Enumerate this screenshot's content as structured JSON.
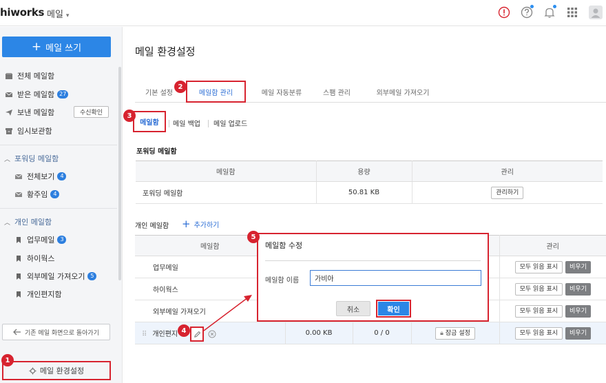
{
  "header": {
    "logo": "hiworks",
    "app_name": "메일",
    "app_caret": "▾",
    "icons": [
      "alert-icon",
      "help-icon",
      "bell-icon",
      "apps-grid-icon",
      "avatar"
    ],
    "accent": "#2c86e6",
    "alert_color": "#d7232f"
  },
  "sidebar": {
    "compose_plus": "+",
    "compose_label": "메일 쓰기",
    "items": [
      {
        "label": "전체 메일함",
        "icon": "mailbox-icon"
      },
      {
        "label": "받은 메일함",
        "icon": "inbox-icon",
        "badge": "27"
      },
      {
        "label": "보낸 메일함",
        "icon": "send-icon",
        "action": "수신확인"
      },
      {
        "label": "임시보관함",
        "icon": "archive-icon"
      }
    ],
    "forward_group": {
      "label": "포워딩 메일함",
      "items": [
        {
          "label": "전체보기",
          "badge": "4"
        },
        {
          "label": "황주임",
          "badge": "4"
        }
      ]
    },
    "personal_group": {
      "label": "개인 메일함",
      "items": [
        {
          "label": "업무메일",
          "badge": "3"
        },
        {
          "label": "하이웍스",
          "badge": ""
        },
        {
          "label": "외부메일 가져오기",
          "badge": "5"
        },
        {
          "label": "개인편지함",
          "badge": ""
        }
      ]
    },
    "old_view": "기존 메일 화면으로 돌아가기",
    "settings": "메일 환경설정"
  },
  "markers": [
    "1",
    "2",
    "3",
    "4",
    "5"
  ],
  "main": {
    "title": "메일 환경설정",
    "tabs": [
      "기본 설정",
      "메일함 관리",
      "메일 자동분류",
      "스팸 관리",
      "외부메일 가져오기"
    ],
    "subtabs": [
      "메일함",
      "메일 백업",
      "메일 업로드"
    ],
    "forward_section": {
      "title": "포워딩 메일함",
      "columns": [
        "메일함",
        "용량",
        "관리"
      ],
      "rows": [
        {
          "name": "포워딩 메일함",
          "size": "50.81 KB",
          "action": "관리하기"
        }
      ]
    },
    "personal_section": {
      "title": "개인 메일함",
      "add_plus": "+",
      "add_label": "추가하기",
      "columns": [
        "메일함",
        "관리"
      ],
      "row_actions": {
        "mark_read": "모두 읽음 표시",
        "empty": "비우기"
      },
      "rows": [
        {
          "name": "업무메일"
        },
        {
          "name": "하이웍스"
        },
        {
          "name": "외부메일 가져오기"
        },
        {
          "name": "개인편지",
          "size": "0.00 KB",
          "count": "0 / 0",
          "lock": "잠금 설정"
        }
      ]
    }
  },
  "dialog": {
    "title": "메일함 수정",
    "field_label": "메일함 이름",
    "field_value": "가비아",
    "cancel": "취소",
    "confirm": "확인"
  }
}
